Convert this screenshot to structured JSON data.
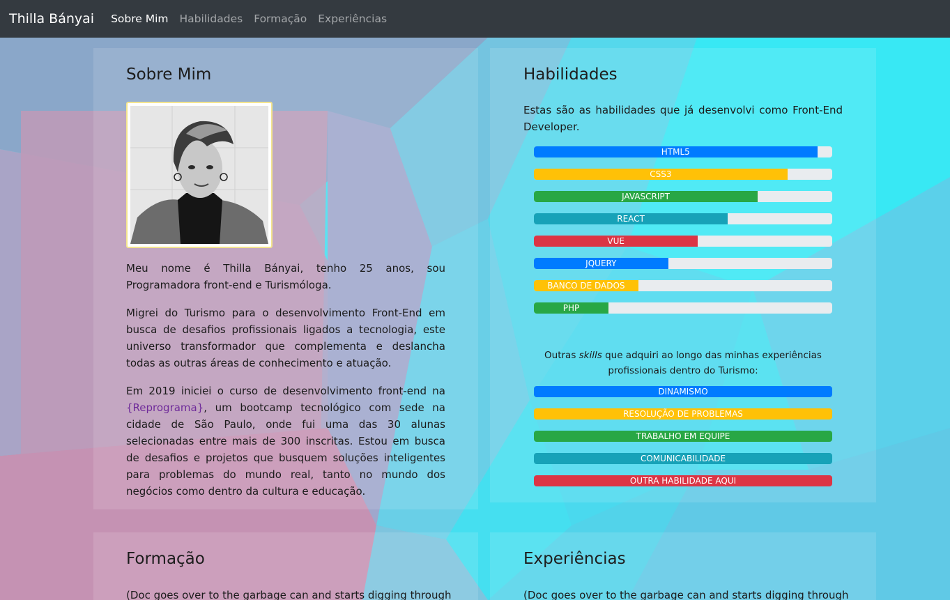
{
  "navbar": {
    "brand": "Thilla Bányai",
    "links": [
      {
        "label": "Sobre Mim",
        "active": true
      },
      {
        "label": "Habilidades",
        "active": false
      },
      {
        "label": "Formação",
        "active": false
      },
      {
        "label": "Experiências",
        "active": false
      }
    ]
  },
  "about": {
    "title": "Sobre Mim",
    "paragraph1": "Meu nome é Thilla Bányai, tenho 25 anos, sou Programadora front-end e Turismóloga.",
    "paragraph2": "Migrei do Turismo para o desenvolvimento Front-End em busca de desafios profissionais ligados a tecnologia, este universo transformador que complementa e deslancha todas as outras áreas de conhecimento e atuação.",
    "paragraph3_before": "Em 2019 iniciei o curso de desenvolvimento front-end na ",
    "paragraph3_link": "{Reprograma}",
    "paragraph3_after": ", um bootcamp tecnológico com sede na cidade de São Paulo, onde fui uma das 30 alunas selecionadas entre mais de 300 inscritas. Estou em busca de desafios e projetos que busquem soluções inteligentes para problemas do mundo real, tanto no mundo dos negócios como dentro da cultura e educação."
  },
  "skills": {
    "title": "Habilidades",
    "intro": "Estas são as habilidades que já desenvolvi como Front-End Developer.",
    "bars": [
      {
        "label": "HTML5",
        "percent": 95,
        "color": "#007bff"
      },
      {
        "label": "CSS3",
        "percent": 85,
        "color": "#ffc107"
      },
      {
        "label": "JAVASCRIPT",
        "percent": 75,
        "color": "#28a745"
      },
      {
        "label": "REACT",
        "percent": 65,
        "color": "#17a2b8"
      },
      {
        "label": "VUE",
        "percent": 55,
        "color": "#dc3545"
      },
      {
        "label": "JQUERY",
        "percent": 45,
        "color": "#007bff"
      },
      {
        "label": "BANCO DE DADOS",
        "percent": 35,
        "color": "#ffc107"
      },
      {
        "label": "PHP",
        "percent": 25,
        "color": "#28a745"
      }
    ],
    "other_before": "Outras ",
    "other_em": "skills",
    "other_after": " que adquiri ao longo das minhas experiências profissionais dentro do Turismo:",
    "soft": [
      {
        "label": "DINAMISMO",
        "color": "#007bff"
      },
      {
        "label": "RESOLUÇÃO DE PROBLEMAS",
        "color": "#ffc107"
      },
      {
        "label": "TRABALHO EM EQUIPE",
        "color": "#28a745"
      },
      {
        "label": "COMUNICABILIDADE",
        "color": "#17a2b8"
      },
      {
        "label": "OUTRA HABILIDADE AQUI",
        "color": "#dc3545"
      }
    ]
  },
  "formacao": {
    "title": "Formação",
    "text": "(Doc goes over to the garbage can and starts digging through"
  },
  "experiencias": {
    "title": "Experiências",
    "text": "(Doc goes over to the garbage can and starts digging through"
  }
}
